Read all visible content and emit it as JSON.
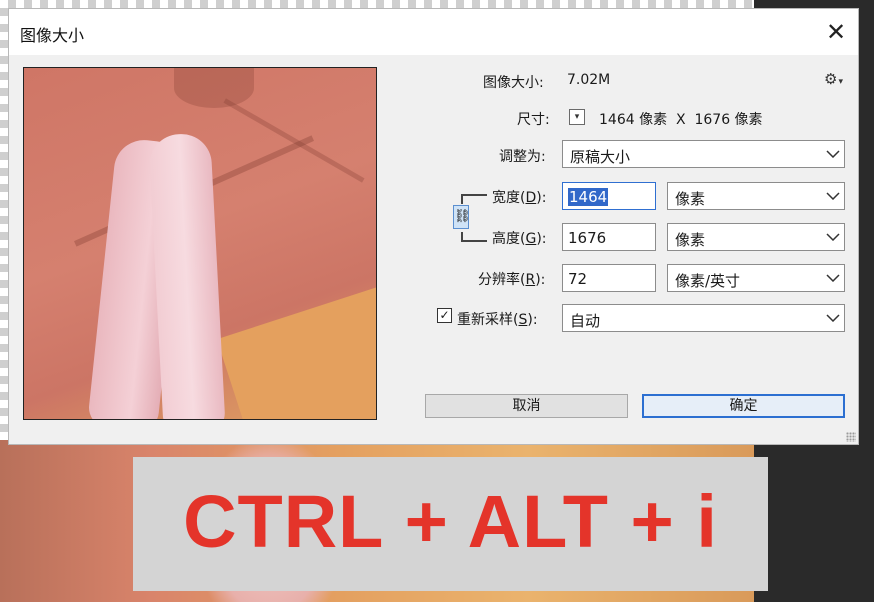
{
  "dialog": {
    "title": "图像大小",
    "image_size_label": "图像大小:",
    "image_size_value": "7.02M",
    "dimensions_label": "尺寸:",
    "dimensions_value": "1464 像素  X  1676 像素",
    "fit_to_label": "调整为:",
    "fit_to_value": "原稿大小",
    "width_label_pre": "宽度(",
    "width_key": "D",
    "width_label_post": "):",
    "width_value": "1464",
    "width_unit": "像素",
    "height_label_pre": "高度(",
    "height_key": "G",
    "height_label_post": "):",
    "height_value": "1676",
    "height_unit": "像素",
    "resolution_label_pre": "分辨率(",
    "resolution_key": "R",
    "resolution_label_post": "):",
    "resolution_value": "72",
    "resolution_unit": "像素/英寸",
    "resample_label_pre": "重新采样(",
    "resample_key": "S",
    "resample_label_post": "):",
    "resample_checked": true,
    "resample_value": "自动",
    "cancel_label": "取消",
    "ok_label": "确定",
    "close_glyph": "✕",
    "check_glyph": "✓"
  },
  "icons": {
    "gear": "gear-icon",
    "link": "link-icon",
    "close": "close-icon",
    "chevron": "chevron-down-icon"
  },
  "banner": {
    "text": "CTRL + ALT + i",
    "color": "#e4342a"
  },
  "colors": {
    "focus_accent": "#2c6fd1",
    "selection": "#3168c9"
  }
}
